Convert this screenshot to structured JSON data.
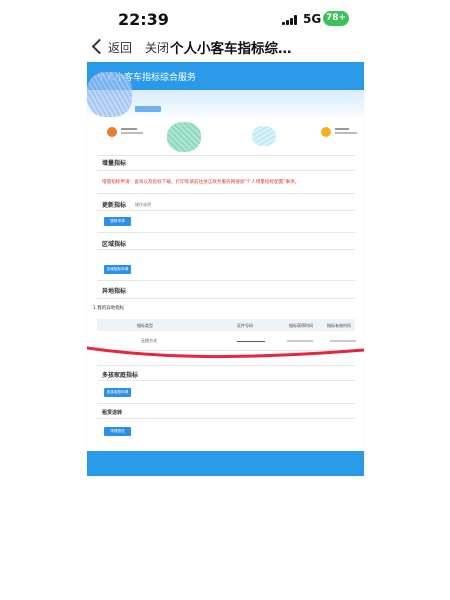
{
  "status": {
    "time": "22:39",
    "network": "5G",
    "battery": "78+"
  },
  "nav": {
    "back_label": "返回",
    "close_label": "关闭",
    "page_title": "个人小客车指标综…"
  },
  "site": {
    "title": "个人小客车指标综合服务"
  },
  "sections": {
    "increment": {
      "title": "增量指标",
      "notice": "增量指标申请：查询以及指标下载，打印等请前往浙江政务服务网搜索\"个人增量指标配置\"事项。"
    },
    "update": {
      "title": "更新指标",
      "sub_label": "操作说明",
      "button": "提前申请"
    },
    "regional": {
      "title": "区域指标",
      "button": "区域指标申请"
    },
    "other_place": {
      "title": "异地指标",
      "table_caption": "1.我的异地指标",
      "columns": [
        "指标类型",
        "证件号码",
        "指标获得时间",
        "指标有效时间"
      ],
      "row": {
        "type": "无偿方式"
      }
    },
    "multi_child": {
      "title": "多孩家庭指标",
      "button": "多孩家庭申请"
    },
    "lease": {
      "title": "租赁退转",
      "button": "申请退还"
    }
  },
  "colors": {
    "header_blue": "#2a9ae8",
    "button_blue": "#2f8ee6",
    "notice_red": "#e03a3a",
    "battery_green": "#3cc25a"
  }
}
